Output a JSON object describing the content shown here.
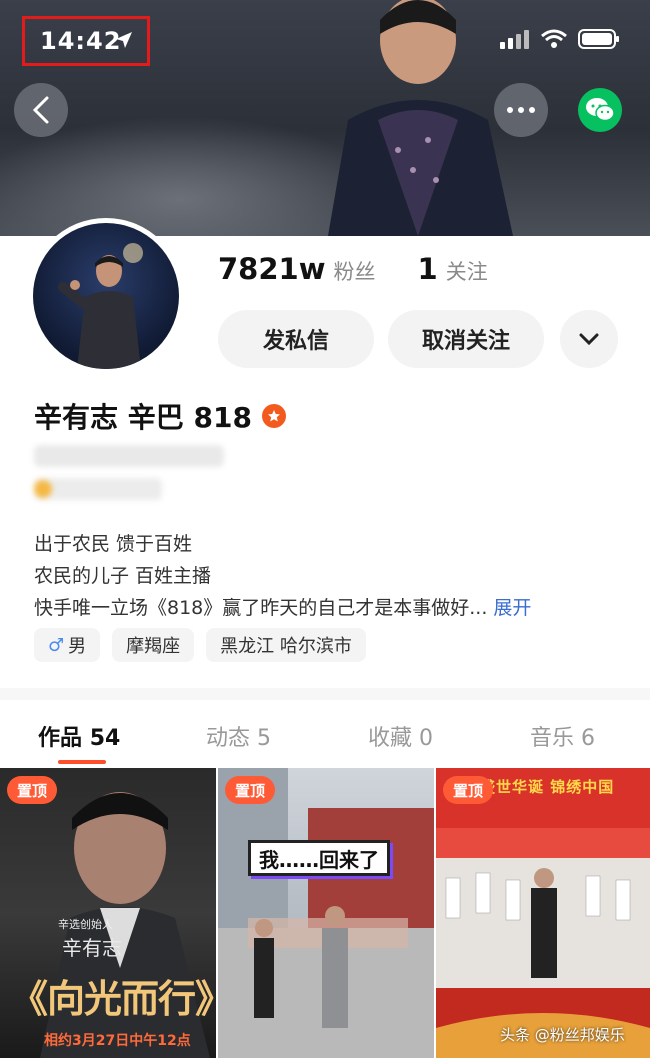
{
  "status_bar": {
    "time": "14:42"
  },
  "profile": {
    "followers_count": "7821w",
    "followers_label": "粉丝",
    "following_count": "1",
    "following_label": "关注",
    "message_button": "发私信",
    "unfollow_button": "取消关注",
    "name": "辛有志 辛巴 818",
    "bio_lines": [
      "出于农民 馈于百姓",
      "农民的儿子  百姓主播",
      "快手唯一立场《818》赢了昨天的自己才是本事做好..."
    ],
    "expand_label": "展开",
    "tags": {
      "gender": "男",
      "zodiac": "摩羯座",
      "location": "黑龙江 哈尔滨市"
    }
  },
  "tabs": [
    {
      "label": "作品",
      "count": "54"
    },
    {
      "label": "动态",
      "count": "5"
    },
    {
      "label": "收藏",
      "count": "0"
    },
    {
      "label": "音乐",
      "count": "6"
    }
  ],
  "grid": {
    "pin_label": "置顶",
    "item1": {
      "title": "《向光而行》",
      "subtitle": "相约3月27日中午12点",
      "tagline": "辛选创始人",
      "signature": "辛有志"
    },
    "item2": {
      "caption": "我……回来了"
    },
    "item3": {
      "banner": "盛世华诞 锦绣中国"
    }
  },
  "watermark": "头条 @粉丝邦娱乐"
}
